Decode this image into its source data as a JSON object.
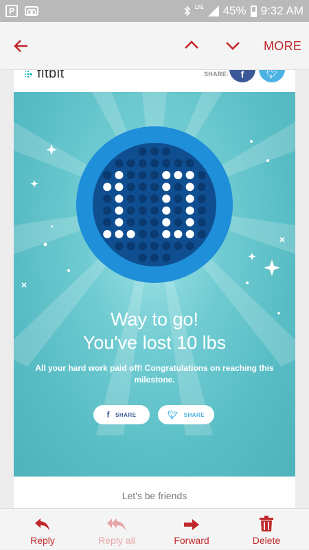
{
  "status_bar": {
    "left_icons": [
      "parking-icon",
      "voicemail-icon"
    ],
    "network": "LTE",
    "battery": "45%",
    "time": "9:32 AM"
  },
  "toolbar": {
    "more_label": "MORE",
    "accent": "#c0282b"
  },
  "email": {
    "brand": "fitbit",
    "share_label": "SHARE:",
    "badge_number": "10",
    "headline_line1": "Way to go!",
    "headline_line2": "You've lost 10 lbs",
    "subtext": "All your hard work paid off! Congratulations on reaching this milestone.",
    "share_buttons": [
      {
        "icon": "facebook-icon",
        "label": "SHARE"
      },
      {
        "icon": "twitter-icon",
        "label": "SHARE"
      }
    ],
    "footer_heading": "Let's be friends",
    "colors": {
      "hero": "#6fcbd1",
      "facebook": "#3b5998",
      "twitter": "#4bb2e3",
      "badge_ring": "#1e8fd8"
    }
  },
  "bottom_bar": {
    "reply_label": "Reply",
    "reply_all_label": "Reply all",
    "forward_label": "Forward",
    "delete_label": "Delete"
  }
}
